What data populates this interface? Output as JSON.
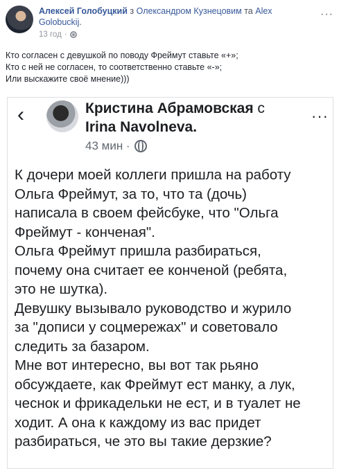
{
  "post": {
    "author": "Алексей Голобуцкий",
    "with_text": " з ",
    "tagged_1": "Олександром Кузнецовим",
    "and_text": " та ",
    "tagged_2": "Alex Golobuckij",
    "tagged_2_line2": "",
    "time": "13 год",
    "more_label": "···",
    "text_lines": [
      "Кто согласен с девушкой по поводу Фреймут ставьте «+»;",
      "Кто с ней не согласен, то соответственно ставьте «-»;",
      "Или выскажите своё мнение)))"
    ]
  },
  "shared": {
    "back_label": "‹",
    "author": "Кристина Абрамовская",
    "with_text": " с",
    "tagged": "Irina Navolneva.",
    "time": "43 мин ·",
    "more_label": "···",
    "body_lines": [
      "К дочери моей коллеги пришла на работу",
      "Ольга Фреймут, за то, что та (дочь)",
      "написала в своем фейсбуке, что \"Ольга",
      "Фреймут - конченая\".",
      "Ольга Фреймут пришла разбираться,",
      "почему она считает ее конченой (ребята,",
      "это не шутка).",
      "Девушку вызывало руководство и журило",
      "за \"дописи у соцмережах\" и советовало",
      "следить за базаром.",
      "Мне вот интересно, вы вот так рьяно",
      "обсуждаете, как Фреймут ест манку, а лук,",
      "чеснок и фрикадельки не ест, и в туалет не",
      "ходит. А она к каждому из вас придет",
      "разбираться, че это вы такие дерзкие?"
    ]
  }
}
